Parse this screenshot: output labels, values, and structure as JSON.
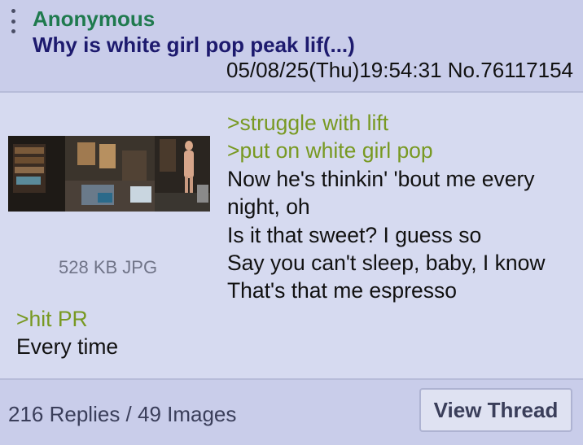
{
  "post": {
    "name": "Anonymous",
    "subject": "Why is white girl pop peak lif(...)",
    "datetime": "05/08/25(Thu)19:54:31",
    "number": "No.76117154",
    "file_info": "528 KB JPG",
    "body_right": [
      {
        "text": ">struggle with lift",
        "greentext": true
      },
      {
        "text": ">put on white girl pop",
        "greentext": true
      },
      {
        "text": "Now he's thinkin' 'bout me every",
        "greentext": false
      },
      {
        "text": "night, oh",
        "greentext": false
      },
      {
        "text": "Is it that sweet? I guess so",
        "greentext": false
      },
      {
        "text": "Say you can't sleep, baby, I know",
        "greentext": false
      },
      {
        "text": "That's that me espresso",
        "greentext": false
      }
    ],
    "body_bottom": [
      {
        "text": ">hit PR",
        "greentext": true
      },
      {
        "text": "Every time",
        "greentext": false
      }
    ]
  },
  "footer": {
    "counts": "216 Replies / 49 Images",
    "view_thread_label": "View Thread"
  },
  "colors": {
    "name": "#1f7a4e",
    "subject": "#1d1a6e",
    "greentext": "#789922",
    "background": "#d6daf0",
    "header_background": "#c9cdea"
  },
  "icons": {
    "menu": "vertical-dots-icon"
  }
}
